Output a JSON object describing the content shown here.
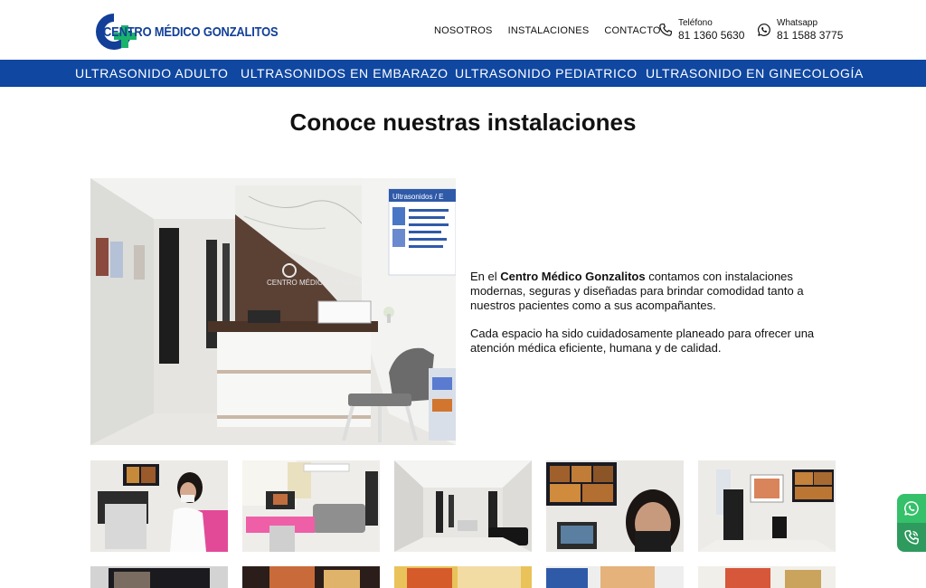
{
  "header": {
    "logo_text": "CENTRO MÉDICO GONZALITOS",
    "nav": [
      "NOSOTROS",
      "INSTALACIONES",
      "CONTACTO"
    ],
    "phone": {
      "label": "Teléfono",
      "value": "81 1360 5630"
    },
    "whatsapp": {
      "label": "Whatsapp",
      "value": "81 1588 3775"
    }
  },
  "service_bar": {
    "items": [
      "ULTRASONIDO ADULTO",
      "ULTRASONIDOS EN EMBARAZO",
      "ULTRASONIDO PEDIATRICO",
      "ULTRASONIDO EN GINECOLOGÍA"
    ]
  },
  "main": {
    "title": "Conoce nuestras instalaciones",
    "para1_before": "En el ",
    "para1_bold": "Centro Médico Gonzalitos",
    "para1_after": " contamos con instalaciones modernas, seguras y diseñadas para brindar comodidad tanto a nuestros pacientes como a sus acompañantes.",
    "para2": "Cada espacio ha sido cuidadosamente planeado para ofrecer una atención médica eficiente, humana y de calidad.",
    "photo_sign_top": "Ultrasonidos / E",
    "photo_sign_logo": "CENTRO MÉDICO GONZALITOS"
  },
  "colors": {
    "brand_blue": "#123f97",
    "bar_blue": "#0f47a1",
    "brand_green": "#19b36b",
    "fab_green": "#35c06a",
    "fab_dark": "#2e9a5e"
  },
  "icons": {
    "phone": "phone-icon",
    "whatsapp": "whatsapp-icon",
    "fab_whatsapp": "whatsapp-icon",
    "fab_call": "call-icon"
  }
}
